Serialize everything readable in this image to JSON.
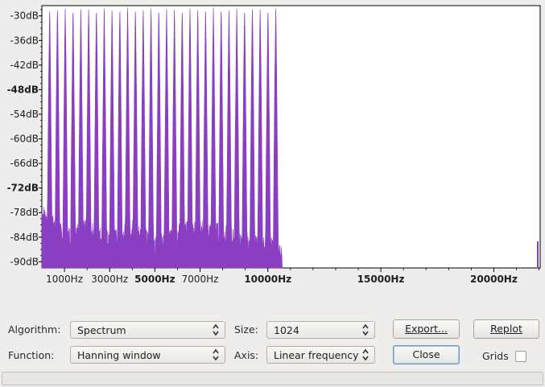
{
  "chart_data": {
    "type": "area",
    "y_tick_labels": [
      "-30dB",
      "-36dB",
      "-42dB",
      "-48dB",
      "-54dB",
      "-60dB",
      "-66dB",
      "-72dB",
      "-78dB",
      "-84dB",
      "-90dB"
    ],
    "y_ticks": [
      -30,
      -36,
      -42,
      -48,
      -54,
      -60,
      -66,
      -72,
      -78,
      -84,
      -90
    ],
    "y_bold": [
      -48,
      -72
    ],
    "ylim": [
      -91.5,
      -27.5
    ],
    "x_tick_labels": [
      "1000Hz",
      "3000Hz",
      "5000Hz",
      "7000Hz",
      "10000Hz",
      "15000Hz",
      "20000Hz"
    ],
    "x_ticks": [
      1000,
      3000,
      5000,
      7000,
      10000,
      15000,
      20000
    ],
    "x_bold": [
      5000,
      10000,
      15000,
      20000
    ],
    "xlim": [
      0,
      22050
    ],
    "fill_color": "#8a3ec2",
    "harmonic_spacing_hz": 345,
    "harmonic_frequencies_hz": [
      345,
      690,
      1035,
      1380,
      1725,
      2070,
      2415,
      2760,
      3105,
      3450,
      3795,
      4140,
      4485,
      4830,
      5175,
      5520,
      5865,
      6210,
      6555,
      6900,
      7245,
      7590,
      7935,
      8280,
      8625,
      8970,
      9315,
      9660,
      10005,
      10350
    ],
    "harmonic_peaks_db": -28,
    "series": [
      {
        "floor_db": [
          [
            0,
            -78
          ],
          [
            1000,
            -84
          ],
          [
            2000,
            -82
          ],
          [
            3000,
            -85
          ],
          [
            4000,
            -82
          ],
          [
            5000,
            -86
          ],
          [
            6000,
            -83
          ],
          [
            7000,
            -82
          ],
          [
            8000,
            -83
          ],
          [
            9000,
            -86
          ],
          [
            10000,
            -86
          ],
          [
            10600,
            -88
          ],
          [
            10650,
            -92
          ]
        ]
      }
    ]
  },
  "controls": {
    "algorithm_label": "Algorithm:",
    "algorithm_value": "Spectrum",
    "size_label": "Size:",
    "size_value": "1024",
    "function_label": "Function:",
    "function_value": "Hanning window",
    "axis_label": "Axis:",
    "axis_value": "Linear frequency",
    "export_label": "Export...",
    "replot_label": "Replot",
    "close_label": "Close",
    "grids_label": "Grids",
    "grids_checked": false
  }
}
